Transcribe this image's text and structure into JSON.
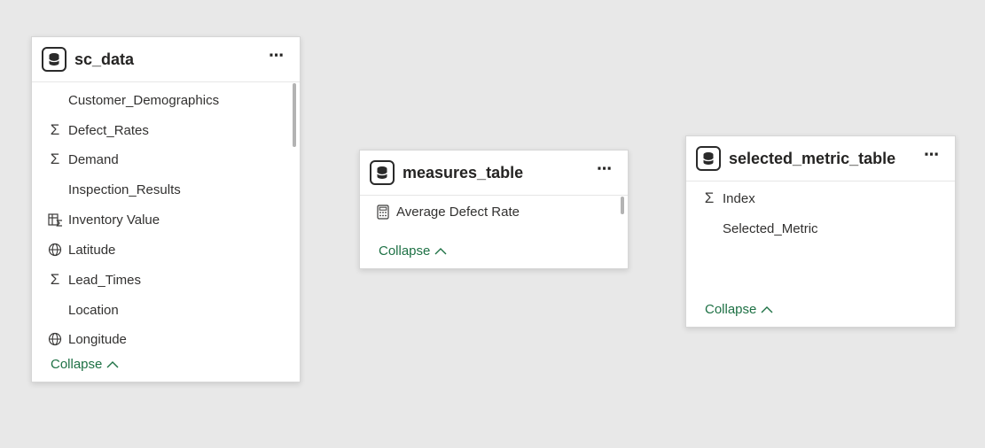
{
  "tables": [
    {
      "title": "sc_data",
      "fields": [
        {
          "label": "Customer_Demographics",
          "icon": "none"
        },
        {
          "label": "Defect_Rates",
          "icon": "sigma-icon"
        },
        {
          "label": "Demand",
          "icon": "sigma-icon"
        },
        {
          "label": "Inspection_Results",
          "icon": "none"
        },
        {
          "label": "Inventory Value",
          "icon": "calculated-column-icon"
        },
        {
          "label": "Latitude",
          "icon": "globe-icon"
        },
        {
          "label": "Lead_Times",
          "icon": "sigma-icon"
        },
        {
          "label": "Location",
          "icon": "none"
        },
        {
          "label": "Longitude",
          "icon": "globe-icon"
        }
      ],
      "collapse_label": "Collapse"
    },
    {
      "title": "measures_table",
      "fields": [
        {
          "label": "Average Defect Rate",
          "icon": "calculator-icon"
        }
      ],
      "collapse_label": "Collapse"
    },
    {
      "title": "selected_metric_table",
      "fields": [
        {
          "label": "Index",
          "icon": "sigma-icon"
        },
        {
          "label": "Selected_Metric",
          "icon": "none"
        }
      ],
      "collapse_label": "Collapse"
    }
  ],
  "more_label": "⋯",
  "sigma_glyph": "Σ",
  "colors": {
    "canvas": "#e8e8e8",
    "card": "#ffffff",
    "collapse_link": "#1e7145",
    "text": "#323130"
  }
}
